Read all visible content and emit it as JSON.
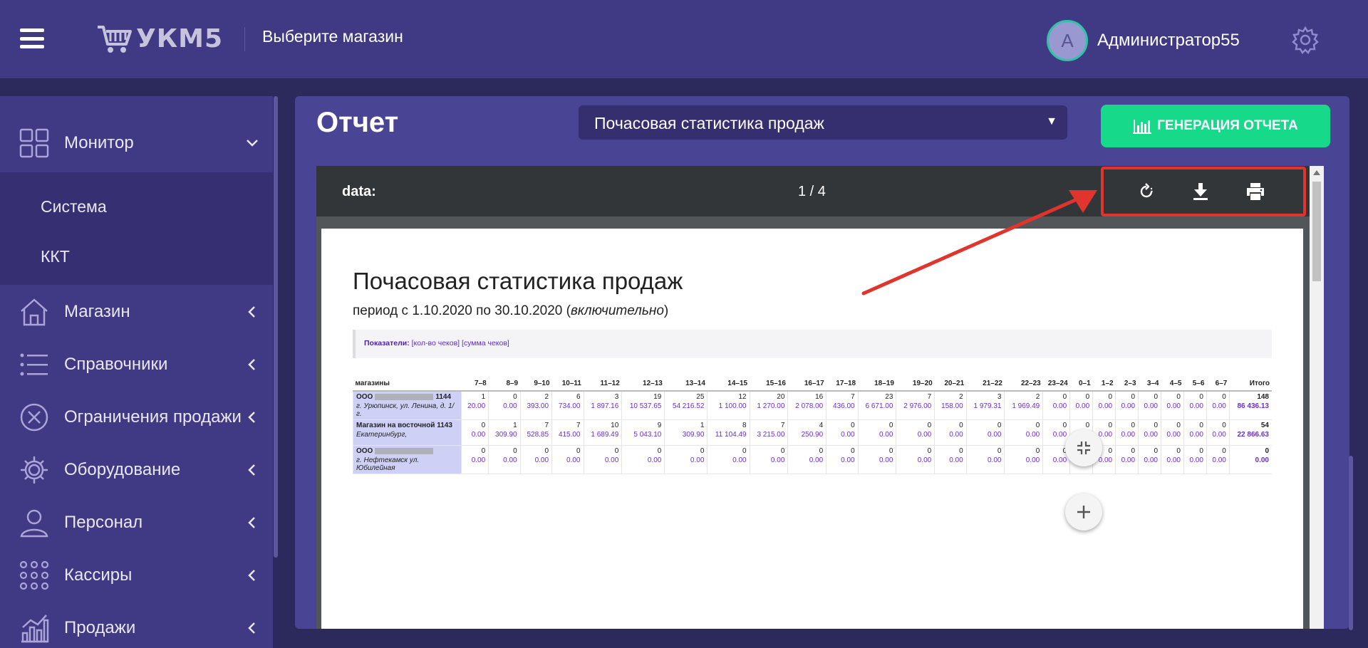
{
  "header": {
    "logo_text": "УКМ5",
    "store_placeholder": "Выберите магазин",
    "avatar_letter": "А",
    "username": "Администратор55"
  },
  "sidebar": {
    "monitor": "Монитор",
    "submenu": [
      "Система",
      "ККТ"
    ],
    "items": [
      {
        "label": "Магазин",
        "icon": "store-icon"
      },
      {
        "label": "Справочники",
        "icon": "list-icon"
      },
      {
        "label": "Ограничения продажи",
        "icon": "restriction-icon"
      },
      {
        "label": "Оборудование",
        "icon": "gear-icon"
      },
      {
        "label": "Персонал",
        "icon": "person-icon"
      },
      {
        "label": "Кассиры",
        "icon": "dots-grid-icon"
      },
      {
        "label": "Продажи",
        "icon": "chart-icon"
      }
    ]
  },
  "main": {
    "title": "Отчет",
    "report_type": "Почасовая статистика продаж",
    "generate_button": "ГЕНЕРАЦИЯ ОТЧЕТА"
  },
  "viewer": {
    "title": "data:",
    "pages": "1 / 4"
  },
  "document": {
    "title": "Почасовая статистика продаж",
    "period_prefix": "период с 1.10.2020 по 30.10.2020 (",
    "period_italic": "включительно",
    "period_suffix": ")",
    "indicators_label": "Показатели:",
    "indicators_values": "[кол-во чеков] [сумма чеков]",
    "columns": [
      "магазины",
      "7–8",
      "8–9",
      "9–10",
      "10–11",
      "11–12",
      "12–13",
      "13–14",
      "14–15",
      "15–16",
      "16–17",
      "17–18",
      "18–19",
      "19–20",
      "20–21",
      "21–22",
      "22–23",
      "23–24",
      "0–1",
      "1–2",
      "2–3",
      "3–4",
      "4–5",
      "5–6",
      "6–7",
      "Итого"
    ],
    "rows": [
      {
        "name_prefix": "ООО",
        "name_suffix": "1144",
        "address": "г. Урюпинск, ул. Ленина, д. 1/г.",
        "counts": [
          "1",
          "0",
          "2",
          "6",
          "3",
          "19",
          "25",
          "12",
          "20",
          "16",
          "7",
          "23",
          "7",
          "2",
          "3",
          "2",
          "0",
          "0",
          "0",
          "0",
          "0",
          "0",
          "0",
          "0",
          "148"
        ],
        "sums": [
          "20.00",
          "0.00",
          "393.00",
          "734.00",
          "1 897.16",
          "10 537.65",
          "54 216.52",
          "1 100.00",
          "1 270.00",
          "2 078.00",
          "436.00",
          "6 671.00",
          "2 976.00",
          "158.00",
          "1 979.31",
          "1 969.49",
          "0.00",
          "0.00",
          "0.00",
          "0.00",
          "0.00",
          "0.00",
          "0.00",
          "0.00",
          "86 436.13"
        ]
      },
      {
        "name_prefix": "Магазин на восточной 1143",
        "name_suffix": "",
        "address": "Екатеринбург,",
        "counts": [
          "0",
          "1",
          "7",
          "7",
          "10",
          "9",
          "1",
          "8",
          "7",
          "4",
          "0",
          "0",
          "0",
          "0",
          "0",
          "0",
          "0",
          "0",
          "0",
          "0",
          "0",
          "0",
          "0",
          "0",
          "54"
        ],
        "sums": [
          "0.00",
          "309.90",
          "528.85",
          "415.00",
          "1 689.49",
          "5 043.10",
          "309.90",
          "11 104.49",
          "3 215.00",
          "250.90",
          "0.00",
          "0.00",
          "0.00",
          "0.00",
          "0.00",
          "0.00",
          "0.00",
          "0.00",
          "0.00",
          "0.00",
          "0.00",
          "0.00",
          "0.00",
          "0.00",
          "22 866.63"
        ]
      },
      {
        "name_prefix": "ООО",
        "name_suffix": "",
        "address": "г. Нефтекамск ул. Юбилейная",
        "counts": [
          "0",
          "0",
          "0",
          "0",
          "0",
          "0",
          "0",
          "0",
          "0",
          "0",
          "0",
          "0",
          "0",
          "0",
          "0",
          "0",
          "0",
          "0",
          "0",
          "0",
          "0",
          "0",
          "0",
          "0",
          "0"
        ],
        "sums": [
          "0.00",
          "0.00",
          "0.00",
          "0.00",
          "0.00",
          "0.00",
          "0.00",
          "0.00",
          "0.00",
          "0.00",
          "0.00",
          "0.00",
          "0.00",
          "0.00",
          "0.00",
          "0.00",
          "0.00",
          "0.00",
          "0.00",
          "0.00",
          "0.00",
          "0.00",
          "0.00",
          "0.00",
          "0.00"
        ]
      }
    ]
  },
  "colors": {
    "header_bg": "#403a84",
    "accent_green": "#16d98a",
    "highlight_red": "#e0342c"
  }
}
